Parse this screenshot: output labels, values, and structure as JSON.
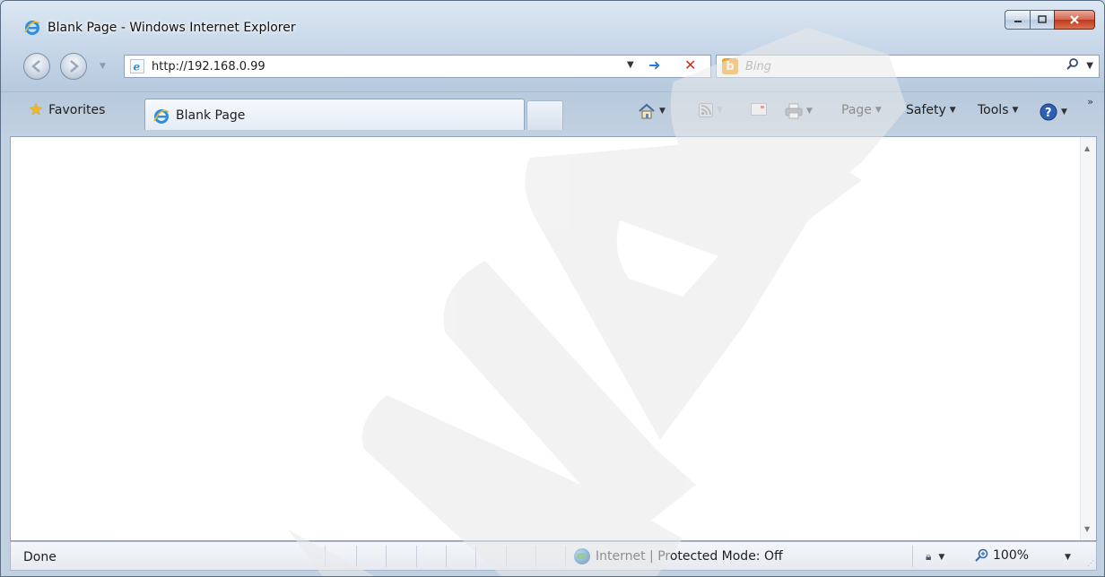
{
  "window": {
    "title": "Blank Page - Windows Internet Explorer",
    "icon": "ie-logo-icon",
    "controls": {
      "minimize": "minimize-icon",
      "maximize": "maximize-icon",
      "close": "close-icon"
    }
  },
  "navigation": {
    "back": "back-arrow-icon",
    "forward": "forward-arrow-icon",
    "address": {
      "value": "http://192.168.0.99"
    },
    "go": "go-arrow-icon",
    "stop": "stop-x-icon",
    "search": {
      "placeholder": "Bing",
      "provider_icon": "bing-icon"
    }
  },
  "command_bar": {
    "favorites_label": "Favorites",
    "tab": {
      "label": "Blank Page"
    },
    "menus": {
      "page": "Page",
      "safety": "Safety",
      "tools": "Tools"
    },
    "icons": [
      "home-icon",
      "feeds-icon",
      "read-mail-icon",
      "print-icon",
      "help-icon"
    ]
  },
  "status": {
    "text": "Done",
    "zone": "Internet | Protected Mode: Off",
    "zoom": "100%"
  },
  "colors": {
    "frame": "#c4d5e7",
    "close_button": "#c0381c",
    "go_arrow": "#2a7ad8",
    "stop": "#c8311f",
    "bing": "#f3a217",
    "watermark": "#e9e9e9"
  }
}
